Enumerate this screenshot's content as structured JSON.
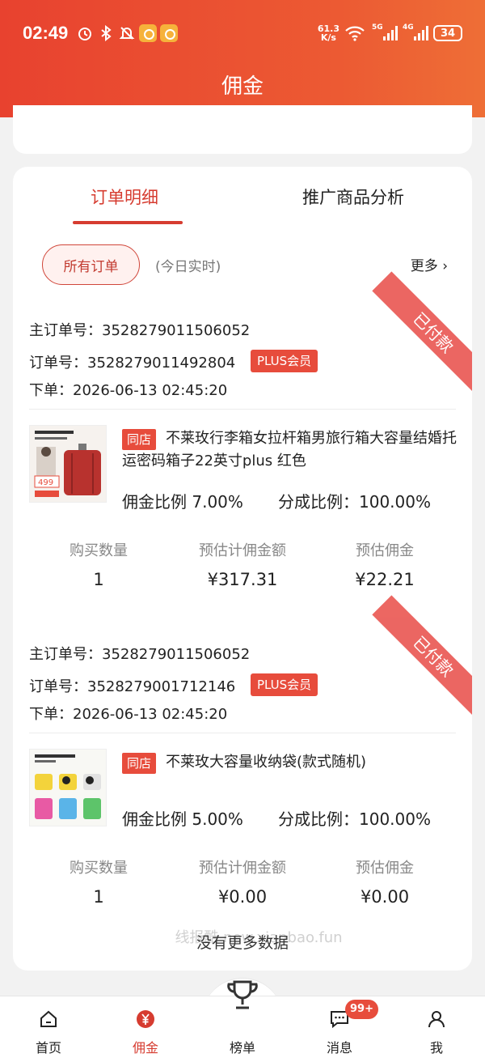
{
  "status_bar": {
    "time": "02:49",
    "speed_value": "61.3",
    "speed_unit": "K/s",
    "net1": "5G",
    "net2": "4G",
    "battery": "34"
  },
  "header": {
    "title": "佣金"
  },
  "tabs": [
    {
      "label": "订单明细",
      "active": true
    },
    {
      "label": "推广商品分析",
      "active": false
    }
  ],
  "filters": {
    "pill_label": "所有订单",
    "sub_label": "(今日实时)",
    "more_label": "更多 ›"
  },
  "orders": [
    {
      "ribbon": "已付款",
      "main_order_label": "主订单号：",
      "main_order_no": "3528279011506052",
      "order_label": "订单号：",
      "order_no": "3528279011492804",
      "member_badge": "PLUS会员",
      "placed_label": "下单：",
      "placed_time": "2026-06-13 02:45:20",
      "store_tag": "同店",
      "product_title": "不莱玫行李箱女拉杆箱男旅行箱大容量结婚托运密码箱子22英寸plus 红色",
      "thumb_price": "499",
      "commission_rate_label": "佣金比例",
      "commission_rate": "7.00%",
      "share_rate_label": "分成比例：",
      "share_rate": "100.00%",
      "stats": {
        "qty_label": "购买数量",
        "qty": "1",
        "est_base_label": "预估计佣金额",
        "est_base": "¥317.31",
        "est_comm_label": "预估佣金",
        "est_comm": "¥22.21"
      }
    },
    {
      "ribbon": "已付款",
      "main_order_label": "主订单号：",
      "main_order_no": "3528279011506052",
      "order_label": "订单号：",
      "order_no": "3528279001712146",
      "member_badge": "PLUS会员",
      "placed_label": "下单：",
      "placed_time": "2026-06-13 02:45:20",
      "store_tag": "同店",
      "product_title": "不莱玫大容量收纳袋(款式随机)",
      "commission_rate_label": "佣金比例",
      "commission_rate": "5.00%",
      "share_rate_label": "分成比例：",
      "share_rate": "100.00%",
      "stats": {
        "qty_label": "购买数量",
        "qty": "1",
        "est_base_label": "预估计佣金额",
        "est_base": "¥0.00",
        "est_comm_label": "预估佣金",
        "est_comm": "¥0.00"
      }
    }
  ],
  "footer": {
    "no_more": "没有更多数据",
    "watermark": "线报酷 new.xianbao.fun"
  },
  "bottom_nav": [
    {
      "label": "首页",
      "icon": "home-icon"
    },
    {
      "label": "佣金",
      "icon": "yuan-icon",
      "active": true
    },
    {
      "label": "榜单",
      "icon": "trophy-icon"
    },
    {
      "label": "消息",
      "icon": "message-icon",
      "badge": "99+"
    },
    {
      "label": "我",
      "icon": "user-icon"
    }
  ],
  "colors": {
    "accent": "#d63c30",
    "header_start": "#e8422f",
    "header_end": "#ee6e36",
    "tag": "#e74c3c"
  }
}
